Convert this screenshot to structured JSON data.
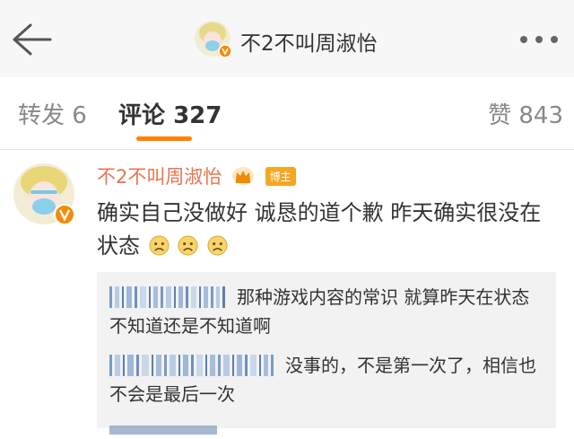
{
  "header": {
    "back_icon": "back-arrow-icon",
    "title": "不2不叫周淑怡",
    "more_icon": "more-dots-icon"
  },
  "tabs": {
    "repost": {
      "label": "转发",
      "count": "6"
    },
    "comment": {
      "label": "评论",
      "count": "327"
    },
    "like": {
      "label": "赞",
      "count": "843"
    },
    "accent_color": "#ff8200"
  },
  "comment": {
    "username": "不2不叫周淑怡",
    "username_color": "#eb7350",
    "badge": "博主",
    "verified_icon": "verified-v-icon",
    "crown_icon": "crown-icon",
    "text": "确实自己没做好 诚恳的道个歉 昨天确实很没在状态",
    "emojis": [
      "sad-face-emoji",
      "sad-face-emoji",
      "sad-face-emoji"
    ]
  },
  "replies": [
    {
      "text": "那种游戏内容的常识  就算昨天在状态  不知道还是不知道啊"
    },
    {
      "text": "没事的，不是第一次了，相信也不会是最后一次"
    }
  ],
  "replies_link_color": "#5d7fab"
}
